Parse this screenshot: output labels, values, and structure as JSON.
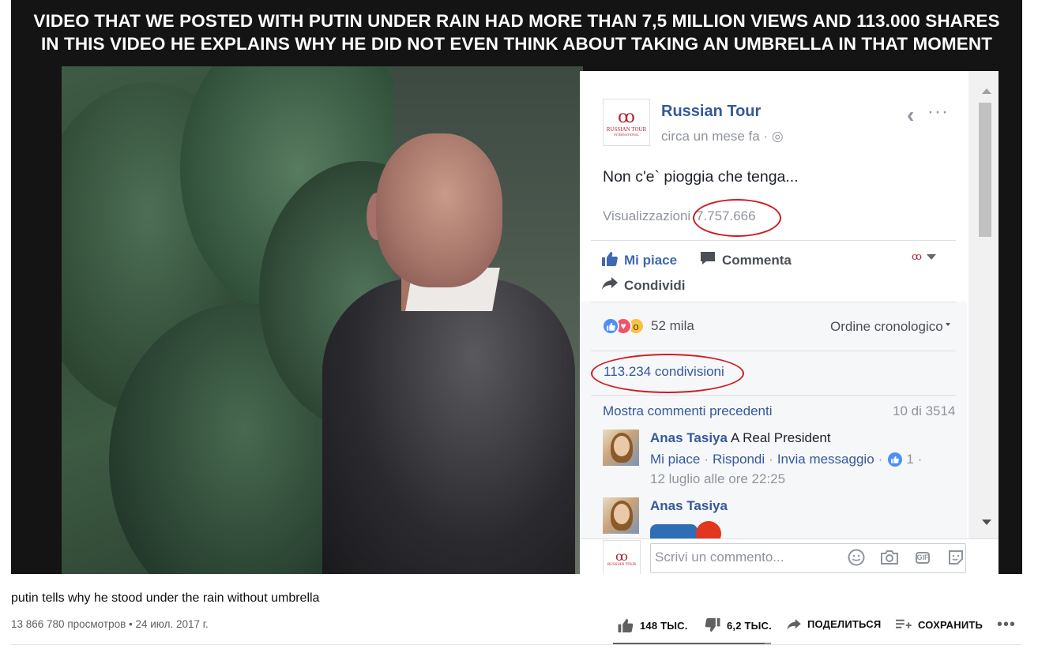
{
  "video": {
    "caption_line1": "VIDEO THAT WE POSTED WITH PUTIN UNDER RAIN HAD MORE THAN 7,5 MILLION VIEWS AND 113.000 SHARES",
    "caption_line2": "IN THIS VIDEO HE EXPLAINS WHY HE DID NOT EVEN THINK ABOUT TAKING AN UMBRELLA IN THAT MOMENT"
  },
  "fb_post": {
    "logo_text_1": "RUSSIAN TOUR",
    "logo_text_2": "INTERNATIONAL",
    "page_name": "Russian Tour",
    "time": "circa un mese fa · ◎",
    "text": "Non c'e` pioggia che tenga...",
    "views_label": "Visualizzazioni",
    "views_value": "7.757.666",
    "actions": {
      "like": "Mi piace",
      "comment": "Commenta",
      "share": "Condividi"
    },
    "reactions_count": "52 mila",
    "order_label": "Ordine cronologico",
    "shares": "113.234 condivisioni",
    "show_previous": "Mostra commenti precedenti",
    "comment_count": "10 di 3514",
    "comments": [
      {
        "author": "Anas Tasiya",
        "text": "A Real President",
        "like": "Mi piace",
        "reply": "Rispondi",
        "message": "Invia messaggio",
        "likes": "1",
        "date": "12 luglio alle ore 22:25"
      },
      {
        "author": "Anas Tasiya"
      }
    ],
    "composer_placeholder": "Scrivi un commento...",
    "gif_label": "GIF"
  },
  "youtube": {
    "title": "putin tells why he stood under the rain without umbrella",
    "stats": "13 866 780 просмотров • 24 июл. 2017 г.",
    "likes": "148 ТЫС.",
    "dislikes": "6,2 ТЫС.",
    "share": "ПОДЕЛИТЬСЯ",
    "save": "СОХРАНИТЬ",
    "more": "•••",
    "like_ratio": 0.96
  },
  "colors": {
    "fb_link": "#365899",
    "circle_annotation": "#d01c23",
    "player_bg": "#141414"
  }
}
